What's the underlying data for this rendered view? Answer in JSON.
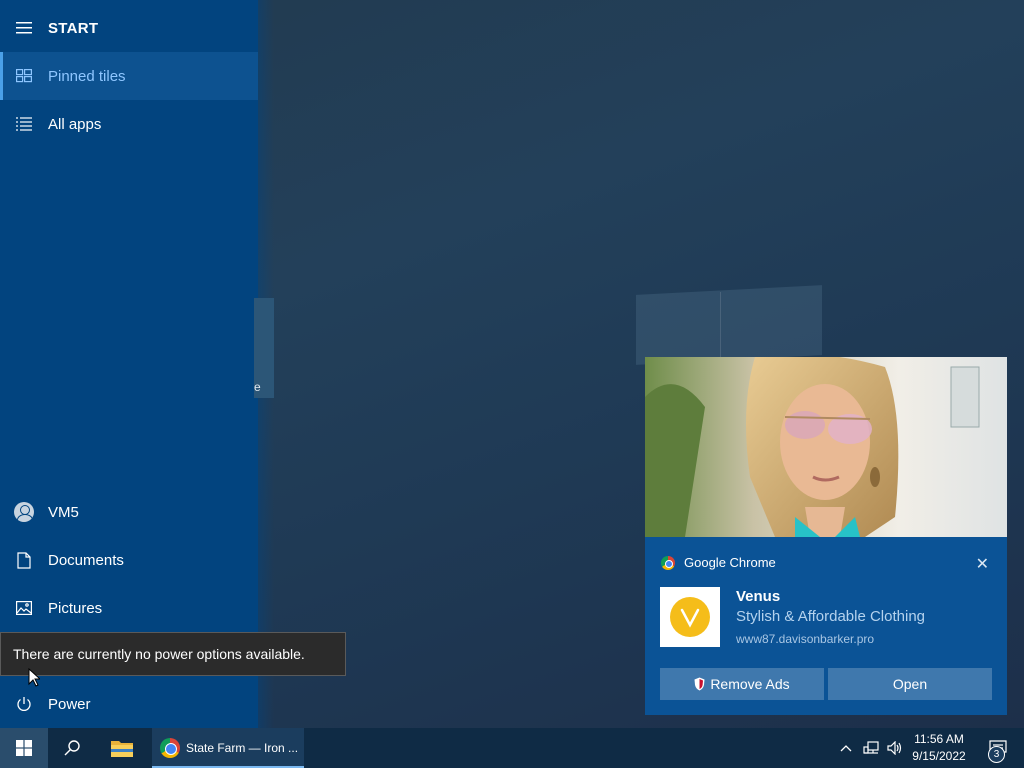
{
  "start_menu": {
    "header_label": "START",
    "items_top": [
      {
        "label": "Pinned tiles",
        "icon": "tiles-icon",
        "selected": true
      },
      {
        "label": "All apps",
        "icon": "list-icon",
        "selected": false
      }
    ],
    "tile_peek_text": "e",
    "user_name": "VM5",
    "items_bottom": [
      {
        "label": "Documents",
        "icon": "document-icon"
      },
      {
        "label": "Pictures",
        "icon": "pictures-icon"
      }
    ],
    "power_label": "Power",
    "power_tooltip": "There are currently no power options available."
  },
  "notification": {
    "app_name": "Google Chrome",
    "title": "Venus",
    "body": "Stylish & Affordable Clothing",
    "url": "www87.davisonbarker.pro",
    "buttons": {
      "remove_ads": "Remove Ads",
      "open": "Open"
    },
    "accent_color": "#0b5396",
    "logo_color": "#f5bd1a"
  },
  "taskbar": {
    "chrome_window_title": "State Farm — Iron ...",
    "time": "11:56 AM",
    "date": "9/15/2022",
    "notification_count": "3"
  }
}
